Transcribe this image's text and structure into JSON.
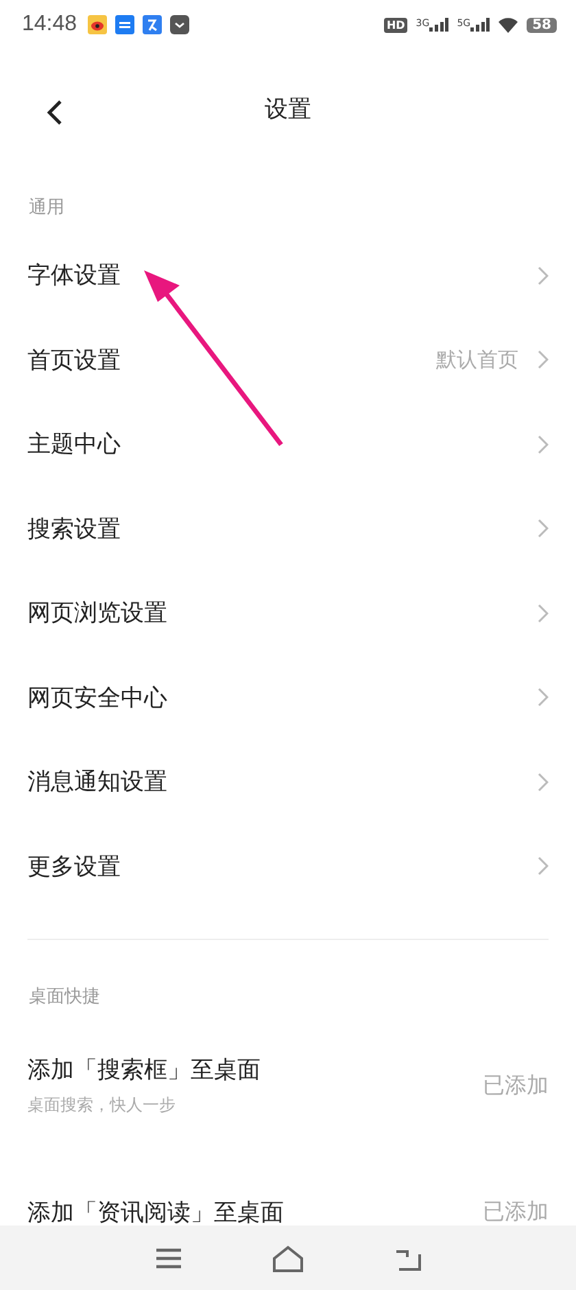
{
  "status_bar": {
    "time": "14:48",
    "hd": "HD",
    "network_1": "3G",
    "network_2": "5G",
    "battery": "58"
  },
  "header": {
    "title": "设置"
  },
  "sections": [
    {
      "title": "通用",
      "items": [
        {
          "kind": "link",
          "label": "字体设置"
        },
        {
          "kind": "link",
          "label": "首页设置",
          "value": "默认首页"
        },
        {
          "kind": "link",
          "label": "主题中心"
        },
        {
          "kind": "link",
          "label": "搜索设置"
        },
        {
          "kind": "link",
          "label": "网页浏览设置"
        },
        {
          "kind": "link",
          "label": "网页安全中心"
        },
        {
          "kind": "link",
          "label": "消息通知设置"
        },
        {
          "kind": "link",
          "label": "更多设置"
        }
      ]
    },
    {
      "title": "桌面快捷",
      "items": [
        {
          "kind": "shortcut",
          "label": "添加「搜索框」至桌面",
          "subtitle": "桌面搜索，快人一步",
          "value": "已添加"
        },
        {
          "kind": "shortcut",
          "label": "添加「资讯阅读」至桌面",
          "value": "已添加"
        }
      ]
    }
  ]
}
